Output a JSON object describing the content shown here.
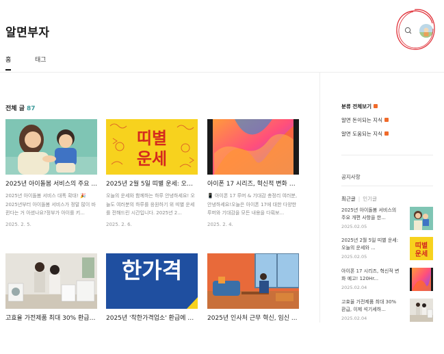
{
  "site": {
    "title": "알면부자"
  },
  "nav": {
    "tabs": [
      {
        "label": "홈"
      },
      {
        "label": "태그"
      }
    ]
  },
  "main": {
    "section_title": "전체 글",
    "count": "87",
    "posts": [
      {
        "title": "2025년 아이돌봄 서비스의 주요 ...",
        "summary": "2025년 아이돌봄 서비스 대폭 확대! 🎉 2025년부터 아이돌봄 서비스가 정말 많이 바뀐다는 거 아셨나요?정부가 아이를 키...",
        "date": "2025. 2. 5.",
        "thumb": "childcare"
      },
      {
        "title": "2025년 2월 5일 띠별 운세: 오늘...",
        "summary": "오늘의 운세와 함께하는 하루 안녕하세요! 오늘도 여러분의 하루를 응원하기 위 띠별 운세를 전해드린 시간입니다. 2025년 2...",
        "date": "2025. 2. 6.",
        "thumb": "fortune"
      },
      {
        "title": "아이폰 17 시리즈, 혁신적 변화 예...",
        "summary": "📱 아이폰 17 루머 & 기대감 총정리 여러분, 안녕하세요!오늘은 아이폰 17에 대한 다양한 루머와 기대감을 모든 내용을 다뤄보...",
        "date": "2025. 2. 4.",
        "thumb": "iphone"
      },
      {
        "title": "고효율 가전제품 최대 30% 환급, ...",
        "summary": "",
        "date": "",
        "thumb": "appliance"
      },
      {
        "title": "2025년 '착한가격업소' 환급에 기...",
        "summary": "",
        "date": "",
        "thumb": "price"
      },
      {
        "title": "2025년 인사처 근무 혁신, 임신 ...",
        "summary": "",
        "date": "",
        "thumb": "office"
      }
    ],
    "price_thumb_text": "한가격"
  },
  "sidebar": {
    "categories": [
      {
        "label": "분류 전체보기",
        "bold": true
      },
      {
        "label": "알면 돈이되는 지식"
      },
      {
        "label": "알면 도움되는 지식"
      }
    ],
    "notice": "공지사항",
    "recent_tab": "최근글",
    "popular_tab": "인기글",
    "recent": [
      {
        "title": "2025년 아이돌봄 서비스의 주요 개편 사항을 한...",
        "date": "2025.02.05",
        "thumb": "childcare"
      },
      {
        "title": "2025년 2월 5일 띠별 운세: 오늘의 운세와 ...",
        "date": "2025.02.05",
        "thumb": "fortune"
      },
      {
        "title": "아이폰 17 시리즈, 혁신적 변화 예고! 120Hr...",
        "date": "2025.02.04",
        "thumb": "iphone"
      },
      {
        "title": "고효율 가전제품 최대 30% 환급, 이제 석기세하...",
        "date": "2025.02.04",
        "thumb": "appliance"
      }
    ]
  },
  "fortune_thumb_text": {
    "line1": "띠별",
    "line2": "운세"
  },
  "colors": {
    "accent": "#3c9a9a",
    "new_badge": "#f06a2a",
    "annotation_circle": "#e0323a"
  }
}
